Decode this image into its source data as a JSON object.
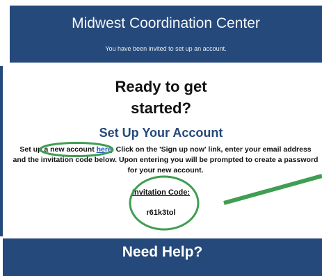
{
  "header": {
    "title": "Midwest Coordination Center",
    "subtitle": "You have been invited to set up an account."
  },
  "main": {
    "headline_line1": "Ready to get",
    "headline_line2": "started?",
    "section_title": "Set Up Your Account",
    "instructions": {
      "prefix": "Set up a new account ",
      "link_text": "here",
      "suffix": ". Click on the 'Sign up now' link, enter your email address and the invitation code below. Upon entering you will be prompted to create a password for your new account."
    },
    "invitation_code_label": "Invitation Code:",
    "invitation_code": "r61k3tol"
  },
  "footer": {
    "help_title": "Need Help?"
  },
  "colors": {
    "brand_blue": "#25497a",
    "highlight_green": "#3f9e52",
    "link_blue": "#1c55c6"
  }
}
